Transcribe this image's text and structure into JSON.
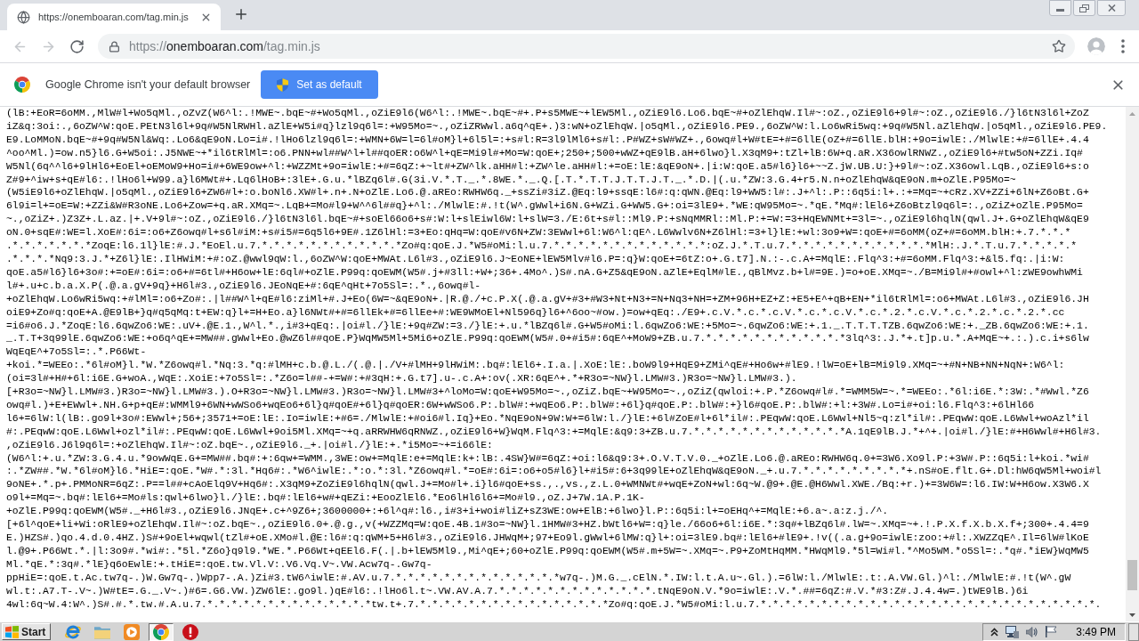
{
  "tab": {
    "title": "https://onemboaran.com/tag.min.js"
  },
  "toolbar": {
    "nav": [
      {
        "kind": "back",
        "disabled": true
      },
      {
        "kind": "forward",
        "disabled": true
      },
      {
        "kind": "reload",
        "disabled": false
      }
    ],
    "url": {
      "scheme": "https://",
      "host": "onemboaran.com",
      "path": "/tag.min.js"
    }
  },
  "infobar": {
    "message": "Google Chrome isn't your default browser",
    "button": "Set as default"
  },
  "page": {
    "lines": [
      "(lB:+EoR=6oMM.,MlW#l+Wo5qMl.,oZvZ(W6^l:.!MWE~.bqE~#+Wo5qMl.,oZiE9l6(W6^l:.!MWE~.bqE~#+.P+s5MWE~+lEW5Ml.,oZiE9l6.Lo6.bqE~#+oZlEhqW.Il#~:oZ.,oZiE9l6+9l#~:oZ.,oZiE9l6./}l6tN3l6l+ZoZ",
      "iZ&q:3oi:.,6oZW^W:qoE.PEtN3l6l+9q#W5NlRWHl.aZlE+W5i#q}lzl9q6l=:+W95Mo=~.,oZiZRWwl.a6q^qE+.)3:wN+oZlEhqW.|o5qMl.,oZiE9l6.PE9.,6oZW^W:l.Lo6wRi5wq:+9q#W5Nl.aZlEhqW.|o5qMl.,oZiE9l6.PE9.",
      "E9.LoMMoN.bqE~#+9q#W5Nl&Wq:.Lo6&qE9oN.Lo=i#.!lHo6lzl9q6l=:+WMN+6W=l=6l#oM}l+6l5l=:+s#l:R=3l9lMl6+s#l:.P#WZ+sW#WZ+.,6owq#l+W#tE=+#=6llE(oZ+#=6llE.blH:+9o=iwlE:./MlwlE:+#=6llE+.4.4",
      "^oo^Ml.)=ow.n5}l6.G+W5oi:.J5NWE~+*il6tRlMl=:o6.PNN+wl##W^l+l##qoER:o6W^l+qE=Mi9l#+Mo=W:qoE+;250+;500+wWZ+qE9lB.aH+6lwo}l.X3qM9+:tZl+lB:6W+q.aR.X36owlRNWZ.,oZiE9l6+#tw5oN+ZZi.Iq#",
      "W5Nl(6q^^l6+9lHl6+EoEl+oEMoW9+Ho=i#+6WE9ow+^l:+WZZMt+9o=iwlE:+#=6qZ:+~lt#+ZW^lk.aHH#l:+ZW^le.aHH#l:+=oE:lE:&qE9oN+.|i:W:qoE.a5#l6}l6+~~Z.jW.UB.U:}+9l#~:oZ.X36owl.LqB.,oZiE9l6+s:o",
      "Z#9+^iw+s+qE#l6:.!lHo6l+W99.a}l6MWt#+.Lq6lHoB+:3lE+.G.u.*lBZq6l#.G(3i.V.*.T._.*.8WE.*._.Q.[.T.*.T.T.J.T.T.J.T._.*.D.|(.u.*ZW:3.G.4+r5.N.n+oZlEhqW&qE9oN.m+oZlE.P95Mo=~",
      "(W5iE9l6+oZlEhqW.|o5qMl.,oZiE9l6+ZW6#l+:o.boNl6.XW#l+.n+.N+oZlE.Lo6.@.aREo:RWHW6q._+ssZi#3iZ.@Eq:l9+ssqE:l6#:q:qWN.@Eq:l9+WW5:l#:.J+^l:.P::6q5i:l+.:+=Mq=~+cRz.XV+ZZi+6lN+Z6oBt.G+",
      "6l9i=l+=oE=W:+ZZi&W#R3oNE.Lo6+Zow=+q.aR.XMq=~.LqB+=Mo#l9+W^^6l##q}+^l:./MlwlE:#.!t(W^.gWwl+i6N.G+WZi.G+WW5.G+:oi=3lE9+.*WE:qW95Mo=~.*qE.*Mq#:lEl6+Z6oBtzl9q6l=:.,oZiZ+oZlE.P95Mo=",
      "~.,oZiZ+.)Z3Z+.L.az.|+.V+9l#~:oZ.,oZiE9l6./}l6tN3l6l.bqE~#+soEl66o6+s#:W:l+slEiwl6W:l+slW=3./E:6t+s#l::Ml9.P:+sNqMMRl::Ml.P:+=W:=3+HqEWNMt+=3l=~.,oZiE9l6hqlN(qwl.J+.G+oZlEhqW&qE9",
      "oN.0+sqE#:WE=l.XoE#:6i=:o6+Z6owq#l+s6l#iM:+s#i5#=6q5l6+9E#.1Z6lHl:=3+Eo:qHq=W:qoE#v6N+ZW:3EWwl+6l:W6^l:qE^.L6Wwlv6N+Z6lHl:=3+l}lE:+wl:3o9+W=:qoE+#=6oMM(oZ+#=6oMM.blH:+.7.*.*.*",
      ".*.*.*.*.*.*.*ZoqE:l6.1l}lE:#.J.*EoEl.u.7.*.*.*.*.*.*.*.*.*.*.*.*Zo#q:qoE.J.*W5#oMi:l.u.7.*.*.*.*.*.*.*.*.*.*.*.*.*:oZ.J.*.T.u.7.*.*.*.*.*.*.*.*.*.*.*.*MlH:.J.*.T.u.7.*.*.*.*.*",
      ".*.*.*.*Nq9:3.J.*+Z6l}lE:.IlHWiM:+#:oZ.@wwl9qW:l.,6oZW^W:qoE+MWAt.L6l#3.,oZiE9l6.J~EoNE+lEW5Mlv#l6.P=:q}W:qoE+=6tZ:o+.G.t7].N.:-.c.A+=MqlE:.Flq^3:+#=6oMM.Flq^3:+&l5.fq:.|i:W:",
      "qoE.a5#l6}l6+3o#:+=oE#:6i=:o6+#=6tl#+H6ow+lE:6ql#+oZlE.P99q:qoEWM(W5#.j+#3ll:+W+;36+.4Mo^.)S#.nA.G+Z5&qE9oN.aZlE+EqlM#lE.,qBlMvz.b+l#=9E.)=o+oE.XMq=~./B=Mi9l#+#owl+^l:zWE9owhWMi",
      "l#+.u+c.b.a.X.P(.@.a.gV+9q}+H6l#3.,oZiE9l6.JEoNqE+#:6qE^qHt+7o5Sl=:.*.,6owq#l-",
      "+oZlEhqW.Lo6wRi5wq:+#lMl=:o6+Zo#:.|l##W^l+qE#l6:ziMl+#.J+Eo(6W=~&qE9oN+.|R.@./+c.P.X(.@.a.gV+#3+#W3+Nt+N3+=N+Nq3+NH=+ZM+96H+EZ+Z:+E5+E^+qB+EN+*il6tRlMl=:o6+MWAt.L6l#3.,oZiE9l6.JH",
      "oiE9+Zo#q:qoE+A.@E9lB+}q#q5qMq:t+EW:q}l+=H+Eo.a}l6NWt#+#=6llEk+#=6llEe+#:WE9WMoEl+Nl596q}l6+^6oo~#ow.)=ow+qEq:./E9+.c.V.*.c.*.c.V.*.c.*.c.V.*.c.*.2.*.c.V.*.c.*.2.*.c.*.2.*.cc",
      "=i6#o6.J.*ZoqE:l6.6qwZo6:WE:.uV+.@E.1.,W^l.*.,i#3+qEq:.|oi#l./}lE:+9q#ZW:=3./}lE:+.u.*lBZq6l#.G+W5#oMi:l.6qwZo6:WE:+5Mo=~.6qwZo6:WE:+.1._.T.T.T.TZB.6qwZo6:WE:+._ZB.6qwZo6:WE:+.1.",
      "_.T.T+3q99lE.6qwZo6:WE:+o6q^qE+=MW##.gWwl+Eo.@wZ6l##qoE.P}WqMW5Ml+5Mi6+oZlE.P99q:qoEWM(W5#.0+#i5#:6qE^+MoW9+ZB.u.7.*.*.*.*.*.*.*.*.*.*.*.*3lq^3:.J.*+.t]p.u.*.A+MqE~+.:.).c.i+s6lw",
      "WqEqE^+7o5Sl=:.*.P66Wt-",
      "+koi.*=WEEo:.*6l#oM}l.*W.*Z6owq#l.*Nq:3.*q:#lMH+c.b.@.L./(.@.|./V+#lMH+9lHWiM:.bq#:lEl6+.I.a.|.XoE:lE:.boW9l9+HqE9+ZMi^qE#+Ho6w+#lE9.!lW=oE+lB=Mi9l9.XMq=~+#N+NB+NN+NqN+:W6^l:",
      "(oi=3l#+H#+6l:i6E.G+woA.,WqE:.XoiE:+7o5Sl=:.*Z6o=l##-+=W#:+#3qH:+.G.t7].u-.c.A+:ov(.XR:6qE^+.*+R3o=~NW}l.LMW#3.)R3o=~NW}l.LMW#3.).",
      "[+R3o=~NW}l.LMW#3.)R3o=~NW}l.LMW#3.).O+R3o=~NW}l.LMW#3.)R3o=~NW}l.LMW#3+^loMo=W:qoE+W95Mo=~.,oZiZ.bqE~+W95Mo=~.,oZiZ(qwloi:+.P.*Z6owq#l#.*=WMM5W=~.*=WEEo:.*6l:i6E.*:3W:.*#Wwl.*Z6",
      "owq#l.)+E+EWwl+.NH.G+p+qE#:WMMl9+6WN+wWSo6+wqEo6+6l}q#qoE#+6l}q#qoER:6W+wWSo6.P:.blW#:+wqEo6.P:.blW#:+6l}q#qoE.P:.blW#:+}l6#qoE.P:.blW#:+l:+3W#.Lo=i#+oi:l6.Flq^3:+6lHl66",
      "l6+=6lW:l(lB:.go9l+3o#:EWwl+;56+;3571+=oE:lE:.Io=iwlE:+#6=./MlwlE:+#oi6#l.Iq}+Eo.*NqE9oN+9W:W+=6lW:l./}lE:+6l#ZoE#l+6l*il#:.PEqwW:qoE.L6Wwl+Nl5~q:zl*il#:.PEqwW:qoE.L6Wwl+woAzl*il",
      "#:.PEqwW:qoE.L6Wwl+ozl*il#:.PEqwW:qoE.L6Wwl+9oi5Ml.XMq=~+q.aRRWHW6qRNWZ.,oZiE9l6+W}WqM.Flq^3:+=MqlE:&q9:3+ZB.u.7.*.*.*.*.*.*.*.*.*.*.*.*.*A.1qE9lB.J.*+^+.|oi#l./}lE:#+H6Wwl#+H6l#3.",
      ",oZiE9l6.J6l9q6l=:+oZlEhqW.Il#~:oZ.bqE~.,oZiE9l6._+.|oi#l./}lE:+.*i5Mo=~+=i66lE:",
      "(W6^l:+.u.*ZW:3.G.4.u.*9owWqE.G+=MW##.bq#:+:6qw+=WMM.,3WE:ow+=MqlE:e+=MqlE:k+:lB:.4SW}W#=6qZ:+oi:l6&q9:3+.O.V.T.V.0._+oZlE.Lo6.@.aREo:RWHW6q.0+=3W6.Xo9l.P:+3W#.P::6q5i:l+koi.*wi#",
      ":.*ZW##.*W.*6l#oM}l6.*HiE=:qoE.*W#.*:3l.*Hq6#:.*W6^iwlE:.*:o.*:3l.*Z6owq#l.*=oE#:6i=:o6+o5#l6}l+#i5#:6+3q99lE+oZlEhqW&qE9oN._+.u.7.*.*.*.*.*.*.*.*.*+.nS#oE.flt.G+.Dl:hW6qW5Ml+woi#l",
      "9oNE+.*.p+.PMMoNR=6qZ:.P==l##+cAoElq9V+Hq6#:.X3qM9+ZoZiE9l6hqlN(qwl.J+=Mo#l+.i}l6#qoE+ss.,.,vs.,z.L.0+WMNWt#+wqE+ZoN+wl:6q~W.@9+.@E.@H6Wwl.XWE./Bq:+r.)+=3W6W=:l6.IW:W+H6ow.X3W6.X",
      "o9l+=Mq=~.bq#:lEl6+=Mo#ls:qwl+6lwo}l./}lE:.bq#:lEl6+w#+qEZi:+EooZlEl6.*Eo6lHl6l6+=Mo#l9.,oZ.J+7W.1A.P.1K-",
      "+oZlE.P99q:qoEWM(W5#._+H6l#3.,oZiE9l6.JNqE+.c+^9Z6+;3600000+:+6l^q#:l6.,i#3+i+woi#liZ+sZ3WE:ow+ElB:+6lwo}l.P::6q5i:l+=oEHq^+=MqlE:+6.a~.a:z.j./^.",
      "[+6l^qoE+li+Wi:oRlE9+oZlEhqW.Il#~:oZ.bqE~.,oZiE9l6.0+.@.g.,v(+WZZMq=W:qoE.4B.1#3o=~NW}l.1HMW#3+HZ.bWtl6+W=:q}le./66o6+6l:i6E.*:3q#+lBZq6l#.lW=~.XMq=~+.!.P.X.f.X.b.X.f+;300+.4.4=9",
      "E.)HZS#.)qo.4.d.0.4HZ.)S#+9oEl+wqwl(tZl#+oE.XMo#l.@E:l6#:q:qWM+5+H6l#3.,oZiE9l6.JHWqM+;97+Eo9l.gWwl+6lMW:q}l+:oi=3lE9.bq#:lEl6+#lE9+.!v((.a.g+9o=iwlE:zoo:+#l:.XWZZqE^.Il=6lW#lKoE",
      "l.@9+.P66Wt.*.|l:3o9#.*wi#:.*5l.*Z6o}q9l9.*WE.*.P66Wt+qEEl6.F(.|.b+lEW5Ml9.,Mi^qE+;60+oZlE.P99q:qoEWM(W5#.m+5W=~.XMq=~.P9+ZoMtHqMM.*HWqMl9.*5l=Wi#l.*^Mo5WM.*o5Sl=:.*q#.*iEW}WqMW5",
      "Ml.*qE.*:3q#.*lE}q6oEwlE:+.tHiE=:qoE.tw.Vl.V:.V6.Vq.V~.VW.Acw7q-.Gw7q-",
      "ppHiE=:qoE.t.Ac.tw7q-.)W.Gw7q-.)Wpp7-.A.)Zi#3.tW6^iwlE:#.AV.u.7.*.*.*.*.*.*.*.*.*.*.*.*.*.*w7q-.)M.G._.cElN.*.IW:l.t.A.u~.Gl.).=6lW:l./MlwlE:.t:.A.VW.Gl.)^l:./MlwlE:#.!t(W^.gW",
      "wl.t:.A7.T-.V~.)W#tE=.G._.V~.)#6=.G6.VW.)ZW6lE:.go9l.)qE#l6:.!lHo6l.t~.VW.AV.A.7.*.*.*.*.*.*.*.*.*.*.*.*.*.tNqE9oN.V.*9o=iwlE:.V.*.##=6qZ:#.V.*#3:Z#.J.4.4w=.)tWE9lB.)6i",
      "4wl:6q~W.4:W^.)S#.#.*.tw.#.A.u.7.*.*.*.*.*.*.*.*.*.*.*.*.*.*tw.t+.7.*.*.*.*.*.*.*.*.*.*.*.*.*.*.*.*Zo#q:qoE.J.*W5#oMi:l.u.7.*.*.*.*.*.*.*.*.*.*.*.*.*.*.*.*.*.*.*.*.*.*.*.*.*.*.*.*."
    ]
  },
  "taskbar": {
    "start": "Start",
    "apps": [
      {
        "kind": "ie",
        "selected": false
      },
      {
        "kind": "folder",
        "selected": false
      },
      {
        "kind": "media",
        "selected": false
      },
      {
        "kind": "chrome",
        "selected": true
      },
      {
        "kind": "alert",
        "selected": false
      }
    ],
    "clock": "3:49 PM"
  }
}
